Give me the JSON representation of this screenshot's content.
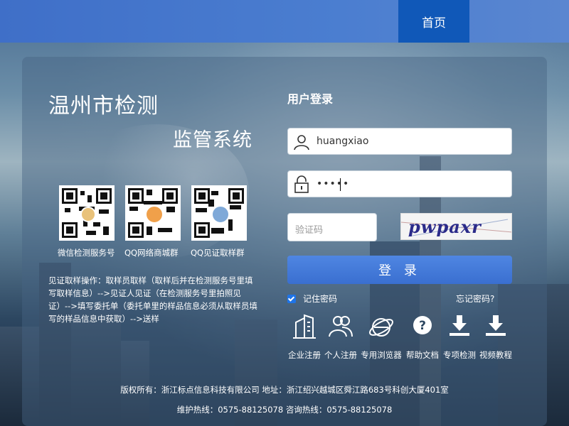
{
  "nav": {
    "home": "首页"
  },
  "system": {
    "title_line1": "温州市检测",
    "title_line2": "监管系统"
  },
  "qr_codes": [
    {
      "label": "微信检测服务号"
    },
    {
      "label": "QQ网络商城群"
    },
    {
      "label": "QQ见证取样群"
    }
  ],
  "guide": {
    "text": "见证取样操作：取样员取样（取样后并在检测服务号里填写取样信息）-->见证人见证（在检测服务号里拍照见证）-->填写委托单（委托单里的样品信息必须从取样员填写的样品信息中获取）-->送样"
  },
  "login": {
    "title": "用户登录",
    "username_value": "huangxiao",
    "password_value": "•••••",
    "captcha_placeholder": "验证码",
    "captcha_text": "pwpaxr",
    "submit_label": "登 录",
    "remember_label": "记住密码",
    "remember_checked": true,
    "forgot_label": "忘记密码?"
  },
  "tools": [
    {
      "label": "企业注册",
      "icon": "building-icon"
    },
    {
      "label": "个人注册",
      "icon": "users-icon"
    },
    {
      "label": "专用浏览器",
      "icon": "browser-icon"
    },
    {
      "label": "帮助文档",
      "icon": "help-icon"
    },
    {
      "label": "专项检测",
      "icon": "download-icon"
    },
    {
      "label": "视频教程",
      "icon": "download-icon"
    }
  ],
  "footer": {
    "copyright": "版权所有：浙江标点信息科技有限公司 地址：浙江绍兴越城区舜江路683号科创大厦401室",
    "hotline": "维护热线：0575-88125078 咨询热线：0575-88125078"
  },
  "colors": {
    "accent": "#1058b8",
    "button": "#3a6fd0",
    "checkbox": "#1e74e8"
  }
}
